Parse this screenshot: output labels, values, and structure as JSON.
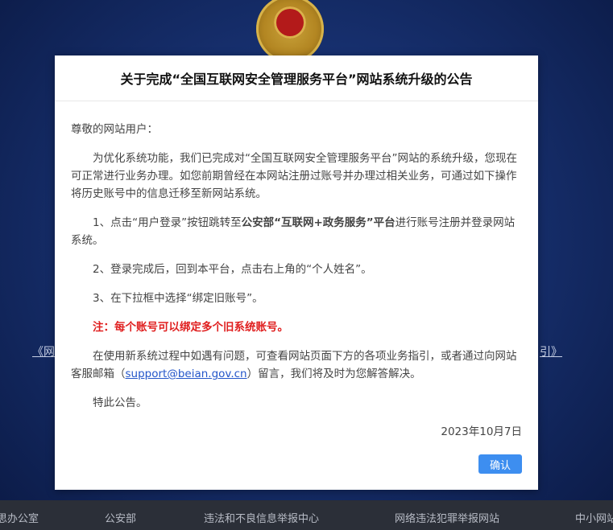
{
  "background": {
    "link_left": "《网",
    "link_right": "引》",
    "footer": [
      "思办公室",
      "公安部",
      "违法和不良信息举报中心",
      "网络违法犯罪举报网站",
      "中小网站"
    ]
  },
  "modal": {
    "title": "关于完成“全国互联网安全管理服务平台”网站系统升级的公告",
    "greeting": "尊敬的网站用户：",
    "p1": "为优化系统功能，我们已完成对“全国互联网安全管理服务平台”网站的系统升级，您现在可正常进行业务办理。如您前期曾经在本网站注册过账号并办理过相关业务，可通过如下操作将历史账号中的信息迁移至新网站系统。",
    "step1_pre": "1、点击“用户登录”按钮跳转至",
    "step1_bold": "公安部“互联网+政务服务”平台",
    "step1_post": "进行账号注册并登录网站系统。",
    "step2": "2、登录完成后，回到本平台，点击右上角的“个人姓名”。",
    "step3": "3、在下拉框中选择“绑定旧账号”。",
    "notice": "注：每个账号可以绑定多个旧系统账号。",
    "help_pre": "在使用新系统过程中如遇有问题，可查看网站页面下方的各项业务指引，或者通过向网站客服邮箱（",
    "email": "support@beian.gov.cn",
    "help_post": "）留言，我们将及时为您解答解决。",
    "closing": "特此公告。",
    "date": "2023年10月7日",
    "confirm_label": "确认"
  }
}
